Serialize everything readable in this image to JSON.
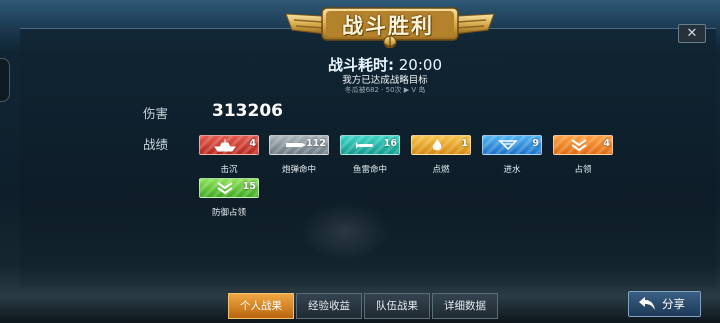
{
  "header": {
    "title": "战斗胜利",
    "duration_label": "战斗耗时:",
    "duration_value": "20:00",
    "objective_text": "我方已达成战略目标",
    "subline": "冬瓜被682 · 50次 ▶  V 岛",
    "close_label": "✕"
  },
  "stats": {
    "damage_label": "伤害",
    "damage_value": "313206",
    "achievements_label": "战绩",
    "badges": [
      {
        "label": "击沉",
        "count": "4",
        "color": "red",
        "icon": "ship-sunk-icon"
      },
      {
        "label": "炮弹命中",
        "count": "112",
        "color": "grey",
        "icon": "shell-hit-icon"
      },
      {
        "label": "鱼雷命中",
        "count": "16",
        "color": "teal",
        "icon": "torpedo-hit-icon"
      },
      {
        "label": "点燃",
        "count": "1",
        "color": "yellow",
        "icon": "fire-icon"
      },
      {
        "label": "进水",
        "count": "9",
        "color": "blue",
        "icon": "flooding-icon"
      },
      {
        "label": "占领",
        "count": "4",
        "color": "orange",
        "icon": "capture-icon"
      },
      {
        "label": "防御占领",
        "count": "15",
        "color": "green",
        "icon": "defend-capture-icon"
      }
    ]
  },
  "tabs": [
    {
      "label": "个人战果",
      "active": true
    },
    {
      "label": "经验收益",
      "active": false
    },
    {
      "label": "队伍战果",
      "active": false
    },
    {
      "label": "详细数据",
      "active": false
    }
  ],
  "share_button": {
    "label": "分享",
    "icon": "share-arrow-icon"
  },
  "colors": {
    "red": "#d0423a",
    "grey": "#8a959d",
    "teal": "#25b8a9",
    "yellow": "#e9a629",
    "blue": "#3691dd",
    "orange": "#f3841f",
    "green": "#62c83c",
    "active_tab": "#e0922e"
  }
}
